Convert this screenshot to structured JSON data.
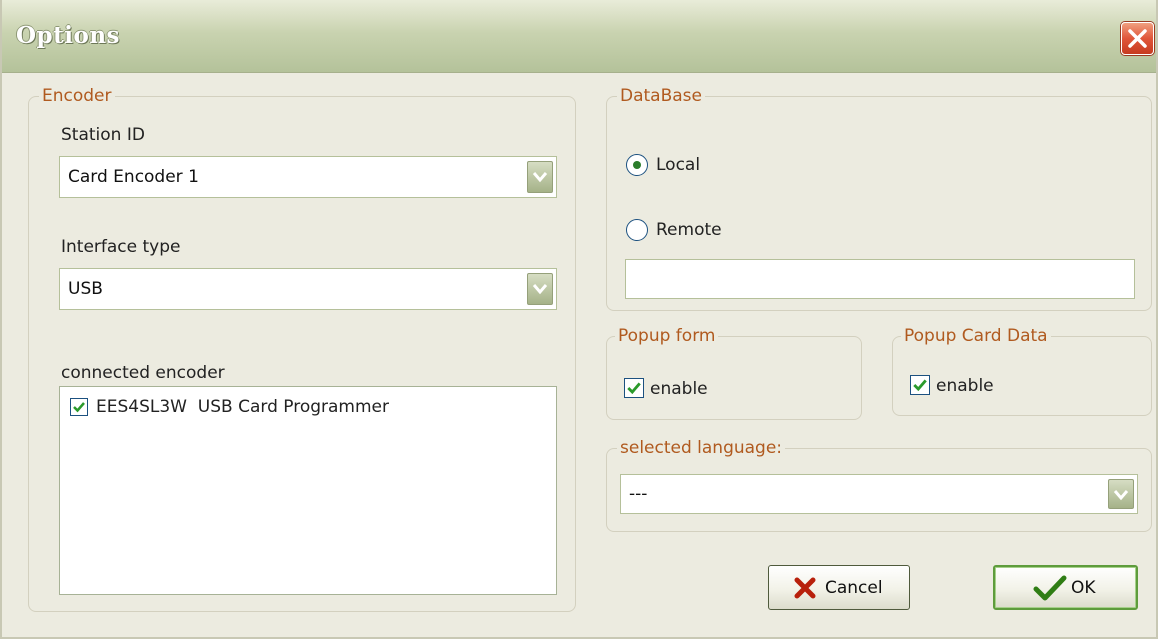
{
  "window": {
    "title": "Options"
  },
  "encoder": {
    "legend": "Encoder",
    "station_label": "Station ID",
    "station_value": "Card Encoder 1",
    "interface_label": "Interface type",
    "interface_value": "USB",
    "connected_label": "connected encoder",
    "connected_items": [
      {
        "label": "EES4SL3W  USB Card Programmer",
        "checked": true
      }
    ]
  },
  "database": {
    "legend": "DataBase",
    "local_label": "Local",
    "remote_label": "Remote",
    "selected": "Local",
    "remote_value": ""
  },
  "popup_form": {
    "legend": "Popup form",
    "enable_label": "enable",
    "checked": true
  },
  "popup_card": {
    "legend": "Popup Card Data",
    "enable_label": "enable",
    "checked": true
  },
  "language": {
    "legend": "selected language:",
    "value": "---"
  },
  "buttons": {
    "cancel": "Cancel",
    "ok": "OK"
  },
  "colors": {
    "legend_text": "#b05a1f",
    "titlebar": "#c9d3b0",
    "check_green": "#2b7d2b",
    "close_red": "#e0563a"
  }
}
